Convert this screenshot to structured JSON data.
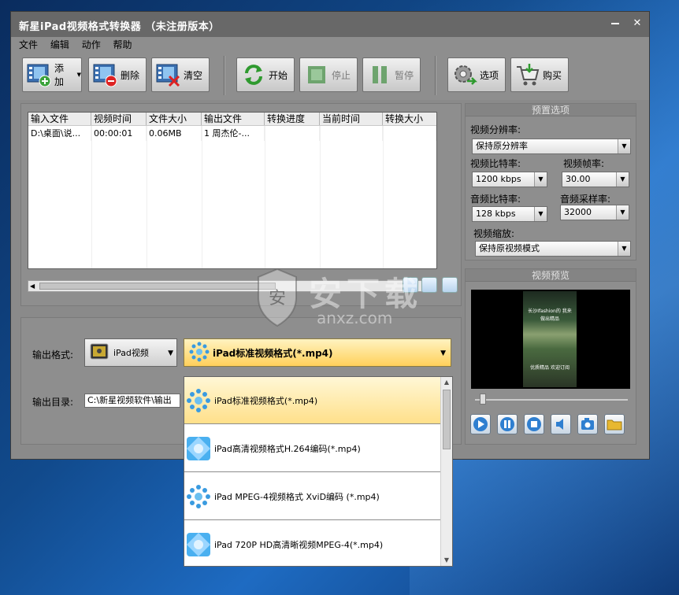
{
  "window": {
    "title": "新星iPad视频格式转换器 （未注册版本）",
    "minimize_icon": "minimize-icon",
    "close_label": "✕"
  },
  "menu": [
    "文件",
    "编辑",
    "动作",
    "帮助"
  ],
  "toolbar": {
    "add": "添加",
    "delete": "删除",
    "clear": "清空",
    "start": "开始",
    "stop": "停止",
    "pause": "暂停",
    "options": "选项",
    "buy": "购买"
  },
  "file_table": {
    "columns": [
      "输入文件",
      "视频时间",
      "文件大小",
      "输出文件",
      "转换进度",
      "当前时间",
      "转换大小"
    ],
    "rows": [
      [
        "D:\\桌面\\说...",
        "00:00:01",
        "0.06MB",
        "1 周杰伦-...",
        "",
        "",
        ""
      ]
    ]
  },
  "output": {
    "format_label": "输出格式:",
    "format_device": "iPad视频",
    "format_preset": "iPad标准视频格式(*.mp4)",
    "dir_label": "输出目录:",
    "dir_value": "C:\\新星视频软件\\输出"
  },
  "preset_options": {
    "title": "预置选项",
    "resolution_label": "视频分辨率:",
    "resolution_value": "保持原分辨率",
    "video_bitrate_label": "视频比特率:",
    "video_bitrate_value": "1200 kbps",
    "framerate_label": "视频帧率:",
    "framerate_value": "30.00",
    "audio_bitrate_label": "音频比特率:",
    "audio_bitrate_value": "128 kbps",
    "samplerate_label": "音频采样率:",
    "samplerate_value": "32000",
    "scale_label": "视频缩放:",
    "scale_value": "保持原视频模式"
  },
  "preview": {
    "title": "视频预览",
    "thumb_top": "长沙Ifashion的 我来",
    "thumb_mid": "做出精品",
    "thumb_bottom": "优质精品 欢迎订阅",
    "seek_position": 0.04
  },
  "dropdown_items": [
    "iPad标准视频格式(*.mp4)",
    "iPad高清视频格式H.264编码(*.mp4)",
    "iPad MPEG-4视频格式 XviD编码 (*.mp4)",
    "iPad 720P HD高清晰视频MPEG-4(*.mp4)"
  ],
  "watermark": {
    "brand": "安下载",
    "domain": "anxz.com"
  },
  "colors": {
    "selected_item": "#ffe08a",
    "window_bg": "#8e8e8e",
    "titlebar": "#686868"
  }
}
